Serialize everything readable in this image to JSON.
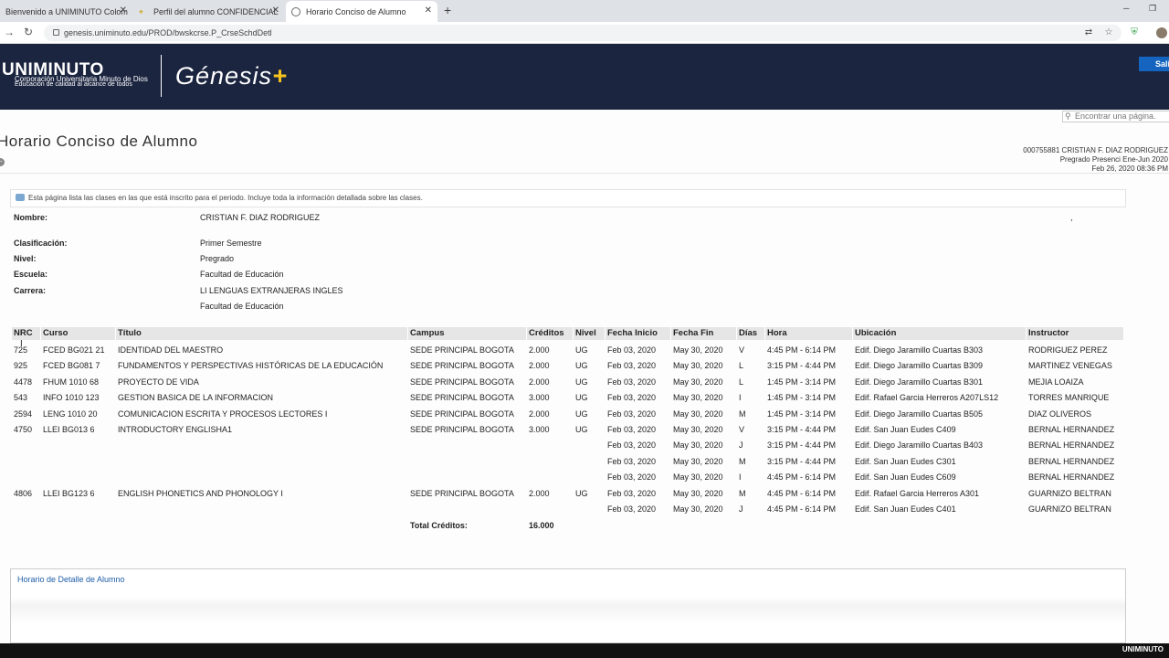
{
  "browser": {
    "tabs": [
      {
        "title": "Bienvenido a UNIMINUTO Colom"
      },
      {
        "title": "Perfil del alumno CONFIDENCIAL"
      },
      {
        "title": "Horario Conciso de Alumno"
      }
    ],
    "new_tab": "+",
    "url": "genesis.uniminuto.edu/PROD/bwskcrse.P_CrseSchdDetl"
  },
  "header": {
    "logo_main": "UNIMINUTO",
    "logo_sub1": "Corporación Universitaria Minuto de Dios",
    "logo_sub2": "Educación de calidad al alcance de todos",
    "genesis": "Génesis",
    "genesis_plus": "+",
    "exit_label": "Sali"
  },
  "search": {
    "placeholder": "Encontrar una página."
  },
  "page": {
    "title": "Horario Conciso de Alumno",
    "info_line1": "000755881 CRISTIAN F. DIAZ RODRIGUEZ",
    "info_line2": "Pregrado Presenci Ene-Jun 2020",
    "info_line3": "Feb 26, 2020 08:36 PM",
    "note": "Esta página lista las clases en las que está inscrito para el periodo. Incluye toda la información detallada sobre las clases.",
    "stray_mark": ","
  },
  "student": {
    "nombre_label": "Nombre:",
    "nombre": "CRISTIAN F. DIAZ RODRIGUEZ",
    "clasif_label": "Clasificación:",
    "clasif": "Primer Semestre",
    "nivel_label": "Nivel:",
    "nivel": "Pregrado",
    "escuela_label": "Escuela:",
    "escuela": "Facultad de Educación",
    "carrera_label": "Carrera:",
    "carrera": "LI LENGUAS EXTRANJERAS INGLES",
    "carrera_fac": "Facultad de Educación"
  },
  "table": {
    "headers": [
      "NRC",
      "Curso",
      "Título",
      "Campus",
      "Créditos",
      "Nivel",
      "Fecha Inicio",
      "Fecha Fin",
      "Días",
      "Hora",
      "Ubicación",
      "Instructor"
    ],
    "rows": [
      [
        "725",
        "FCED BG021 21",
        "IDENTIDAD DEL MAESTRO",
        "SEDE PRINCIPAL BOGOTA",
        "2.000",
        "UG",
        "Feb 03, 2020",
        "May 30, 2020",
        "V",
        "4:45 PM - 6:14 PM",
        "Edif. Diego Jaramillo Cuartas B303",
        "RODRIGUEZ PEREZ"
      ],
      [
        "925",
        "FCED BG081 7",
        "FUNDAMENTOS Y PERSPECTIVAS HISTÓRICAS DE LA EDUCACIÓN",
        "SEDE PRINCIPAL BOGOTA",
        "2.000",
        "UG",
        "Feb 03, 2020",
        "May 30, 2020",
        "L",
        "3:15 PM - 4:44 PM",
        "Edif. Diego Jaramillo Cuartas B309",
        "MARTINEZ VENEGAS"
      ],
      [
        "4478",
        "FHUM 1010 68",
        "PROYECTO DE VIDA",
        "SEDE PRINCIPAL BOGOTA",
        "2.000",
        "UG",
        "Feb 03, 2020",
        "May 30, 2020",
        "L",
        "1:45 PM - 3:14 PM",
        "Edif. Diego Jaramillo Cuartas B301",
        "MEJIA LOAIZA"
      ],
      [
        "543",
        "INFO 1010 123",
        "GESTION BASICA DE LA INFORMACION",
        "SEDE PRINCIPAL BOGOTA",
        "3.000",
        "UG",
        "Feb 03, 2020",
        "May 30, 2020",
        "I",
        "1:45 PM - 3:14 PM",
        "Edif. Rafael Garcia Herreros A207LS12",
        "TORRES MANRIQUE"
      ],
      [
        "2594",
        "LENG 1010 20",
        "COMUNICACION ESCRITA Y PROCESOS LECTORES I",
        "SEDE PRINCIPAL BOGOTA",
        "2.000",
        "UG",
        "Feb 03, 2020",
        "May 30, 2020",
        "M",
        "1:45 PM - 3:14 PM",
        "Edif. Diego Jaramillo Cuartas B505",
        "DIAZ OLIVEROS"
      ],
      [
        "4750",
        "LLEI BG013 6",
        "INTRODUCTORY ENGLISHA1",
        "SEDE PRINCIPAL BOGOTA",
        "3.000",
        "UG",
        "Feb 03, 2020",
        "May 30, 2020",
        "V",
        "3:15 PM - 4:44 PM",
        "Edif. San Juan Eudes C409",
        "BERNAL HERNANDEZ"
      ],
      [
        "",
        "",
        "",
        "",
        "",
        "",
        "Feb 03, 2020",
        "May 30, 2020",
        "J",
        "3:15 PM - 4:44 PM",
        "Edif. Diego Jaramillo Cuartas B403",
        "BERNAL HERNANDEZ"
      ],
      [
        "",
        "",
        "",
        "",
        "",
        "",
        "Feb 03, 2020",
        "May 30, 2020",
        "M",
        "3:15 PM - 4:44 PM",
        "Edif. San Juan Eudes C301",
        "BERNAL HERNANDEZ"
      ],
      [
        "",
        "",
        "",
        "",
        "",
        "",
        "Feb 03, 2020",
        "May 30, 2020",
        "I",
        "4:45 PM - 6:14 PM",
        "Edif. San Juan Eudes C609",
        "BERNAL HERNANDEZ"
      ],
      [
        "4806",
        "LLEI BG123 6",
        "ENGLISH PHONETICS AND PHONOLOGY I",
        "SEDE PRINCIPAL BOGOTA",
        "2.000",
        "UG",
        "Feb 03, 2020",
        "May 30, 2020",
        "M",
        "4:45 PM - 6:14 PM",
        "Edif. Rafael Garcia Herreros A301",
        "GUARNIZO BELTRAN"
      ],
      [
        "",
        "",
        "",
        "",
        "",
        "",
        "Feb 03, 2020",
        "May 30, 2020",
        "J",
        "4:45 PM - 6:14 PM",
        "Edif. San Juan Eudes C401",
        "GUARNIZO BELTRAN"
      ]
    ],
    "total_label": "Total Créditos:",
    "total_value": "16.000"
  },
  "bottom": {
    "link": "Horario de Detalle de Alumno"
  },
  "footer": {
    "logo": "UNIMINUTO"
  }
}
